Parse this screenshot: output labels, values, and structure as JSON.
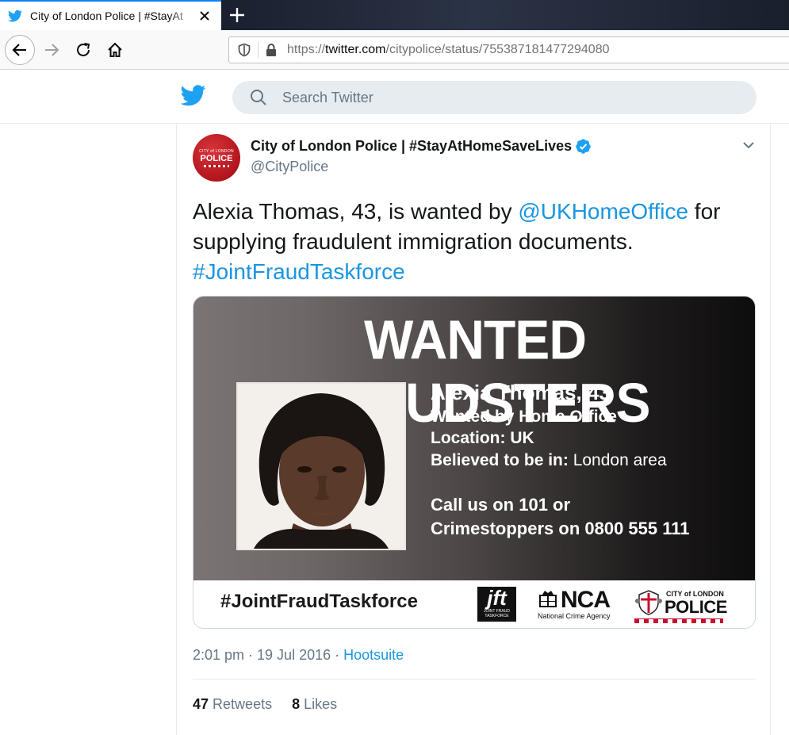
{
  "browser": {
    "tab_title": "City of London Police | #StayAt",
    "url_scheme": "https://",
    "url_host": "twitter.com",
    "url_path": "/citypolice/status/755387181477294080"
  },
  "twitter": {
    "search_placeholder": "Search Twitter",
    "brand_color": "#1da1f2"
  },
  "tweet": {
    "display_name": "City of London Police | #StayAtHomeSaveLives",
    "handle": "@CityPolice",
    "avatar_text_small": "CITY of LONDON",
    "avatar_text_big": "POLICE",
    "text_part1": "Alexia Thomas, 43, is wanted by ",
    "mention": "@UKHomeOffice",
    "text_part2": " for supplying fraudulent immigration documents.",
    "hashtag": "#JointFraudTaskforce",
    "timestamp": "2:01 pm · 19 Jul 2016 · ",
    "source": "Hootsuite",
    "retweets_count": "47",
    "retweets_label": "Retweets",
    "likes_count": "8",
    "likes_label": "Likes"
  },
  "poster": {
    "title": "WANTED FRAUDSTERS",
    "name": "Alexia Thomas, 43",
    "wanted_by": "Wanted by Home Office",
    "location": "Location: UK",
    "believed_label": "Believed to be in: ",
    "believed_value": "London area",
    "call_line1": "Call us on 101 or",
    "call_line2": "Crimestoppers on 0800 555 111",
    "footer_tag": "#JointFraudTaskforce",
    "jft_big": "jft",
    "jft_small": "JOINT FRAUD TASKFORCE",
    "nca_big": "NCA",
    "nca_sub": "National Crime Agency",
    "colp_small": "CITY of LONDON",
    "colp_big": "POLICE"
  }
}
